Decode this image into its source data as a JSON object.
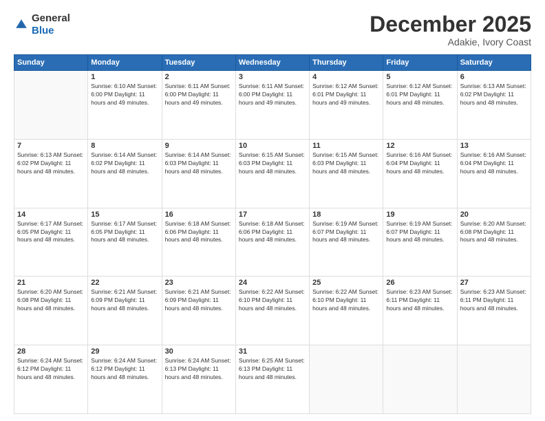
{
  "header": {
    "logo_general": "General",
    "logo_blue": "Blue",
    "month_title": "December 2025",
    "location": "Adakie, Ivory Coast"
  },
  "days_of_week": [
    "Sunday",
    "Monday",
    "Tuesday",
    "Wednesday",
    "Thursday",
    "Friday",
    "Saturday"
  ],
  "weeks": [
    [
      {
        "day": "",
        "info": ""
      },
      {
        "day": "1",
        "info": "Sunrise: 6:10 AM\nSunset: 6:00 PM\nDaylight: 11 hours\nand 49 minutes."
      },
      {
        "day": "2",
        "info": "Sunrise: 6:11 AM\nSunset: 6:00 PM\nDaylight: 11 hours\nand 49 minutes."
      },
      {
        "day": "3",
        "info": "Sunrise: 6:11 AM\nSunset: 6:00 PM\nDaylight: 11 hours\nand 49 minutes."
      },
      {
        "day": "4",
        "info": "Sunrise: 6:12 AM\nSunset: 6:01 PM\nDaylight: 11 hours\nand 49 minutes."
      },
      {
        "day": "5",
        "info": "Sunrise: 6:12 AM\nSunset: 6:01 PM\nDaylight: 11 hours\nand 48 minutes."
      },
      {
        "day": "6",
        "info": "Sunrise: 6:13 AM\nSunset: 6:02 PM\nDaylight: 11 hours\nand 48 minutes."
      }
    ],
    [
      {
        "day": "7",
        "info": "Sunrise: 6:13 AM\nSunset: 6:02 PM\nDaylight: 11 hours\nand 48 minutes."
      },
      {
        "day": "8",
        "info": "Sunrise: 6:14 AM\nSunset: 6:02 PM\nDaylight: 11 hours\nand 48 minutes."
      },
      {
        "day": "9",
        "info": "Sunrise: 6:14 AM\nSunset: 6:03 PM\nDaylight: 11 hours\nand 48 minutes."
      },
      {
        "day": "10",
        "info": "Sunrise: 6:15 AM\nSunset: 6:03 PM\nDaylight: 11 hours\nand 48 minutes."
      },
      {
        "day": "11",
        "info": "Sunrise: 6:15 AM\nSunset: 6:03 PM\nDaylight: 11 hours\nand 48 minutes."
      },
      {
        "day": "12",
        "info": "Sunrise: 6:16 AM\nSunset: 6:04 PM\nDaylight: 11 hours\nand 48 minutes."
      },
      {
        "day": "13",
        "info": "Sunrise: 6:16 AM\nSunset: 6:04 PM\nDaylight: 11 hours\nand 48 minutes."
      }
    ],
    [
      {
        "day": "14",
        "info": "Sunrise: 6:17 AM\nSunset: 6:05 PM\nDaylight: 11 hours\nand 48 minutes."
      },
      {
        "day": "15",
        "info": "Sunrise: 6:17 AM\nSunset: 6:05 PM\nDaylight: 11 hours\nand 48 minutes."
      },
      {
        "day": "16",
        "info": "Sunrise: 6:18 AM\nSunset: 6:06 PM\nDaylight: 11 hours\nand 48 minutes."
      },
      {
        "day": "17",
        "info": "Sunrise: 6:18 AM\nSunset: 6:06 PM\nDaylight: 11 hours\nand 48 minutes."
      },
      {
        "day": "18",
        "info": "Sunrise: 6:19 AM\nSunset: 6:07 PM\nDaylight: 11 hours\nand 48 minutes."
      },
      {
        "day": "19",
        "info": "Sunrise: 6:19 AM\nSunset: 6:07 PM\nDaylight: 11 hours\nand 48 minutes."
      },
      {
        "day": "20",
        "info": "Sunrise: 6:20 AM\nSunset: 6:08 PM\nDaylight: 11 hours\nand 48 minutes."
      }
    ],
    [
      {
        "day": "21",
        "info": "Sunrise: 6:20 AM\nSunset: 6:08 PM\nDaylight: 11 hours\nand 48 minutes."
      },
      {
        "day": "22",
        "info": "Sunrise: 6:21 AM\nSunset: 6:09 PM\nDaylight: 11 hours\nand 48 minutes."
      },
      {
        "day": "23",
        "info": "Sunrise: 6:21 AM\nSunset: 6:09 PM\nDaylight: 11 hours\nand 48 minutes."
      },
      {
        "day": "24",
        "info": "Sunrise: 6:22 AM\nSunset: 6:10 PM\nDaylight: 11 hours\nand 48 minutes."
      },
      {
        "day": "25",
        "info": "Sunrise: 6:22 AM\nSunset: 6:10 PM\nDaylight: 11 hours\nand 48 minutes."
      },
      {
        "day": "26",
        "info": "Sunrise: 6:23 AM\nSunset: 6:11 PM\nDaylight: 11 hours\nand 48 minutes."
      },
      {
        "day": "27",
        "info": "Sunrise: 6:23 AM\nSunset: 6:11 PM\nDaylight: 11 hours\nand 48 minutes."
      }
    ],
    [
      {
        "day": "28",
        "info": "Sunrise: 6:24 AM\nSunset: 6:12 PM\nDaylight: 11 hours\nand 48 minutes."
      },
      {
        "day": "29",
        "info": "Sunrise: 6:24 AM\nSunset: 6:12 PM\nDaylight: 11 hours\nand 48 minutes."
      },
      {
        "day": "30",
        "info": "Sunrise: 6:24 AM\nSunset: 6:13 PM\nDaylight: 11 hours\nand 48 minutes."
      },
      {
        "day": "31",
        "info": "Sunrise: 6:25 AM\nSunset: 6:13 PM\nDaylight: 11 hours\nand 48 minutes."
      },
      {
        "day": "",
        "info": ""
      },
      {
        "day": "",
        "info": ""
      },
      {
        "day": "",
        "info": ""
      }
    ]
  ]
}
